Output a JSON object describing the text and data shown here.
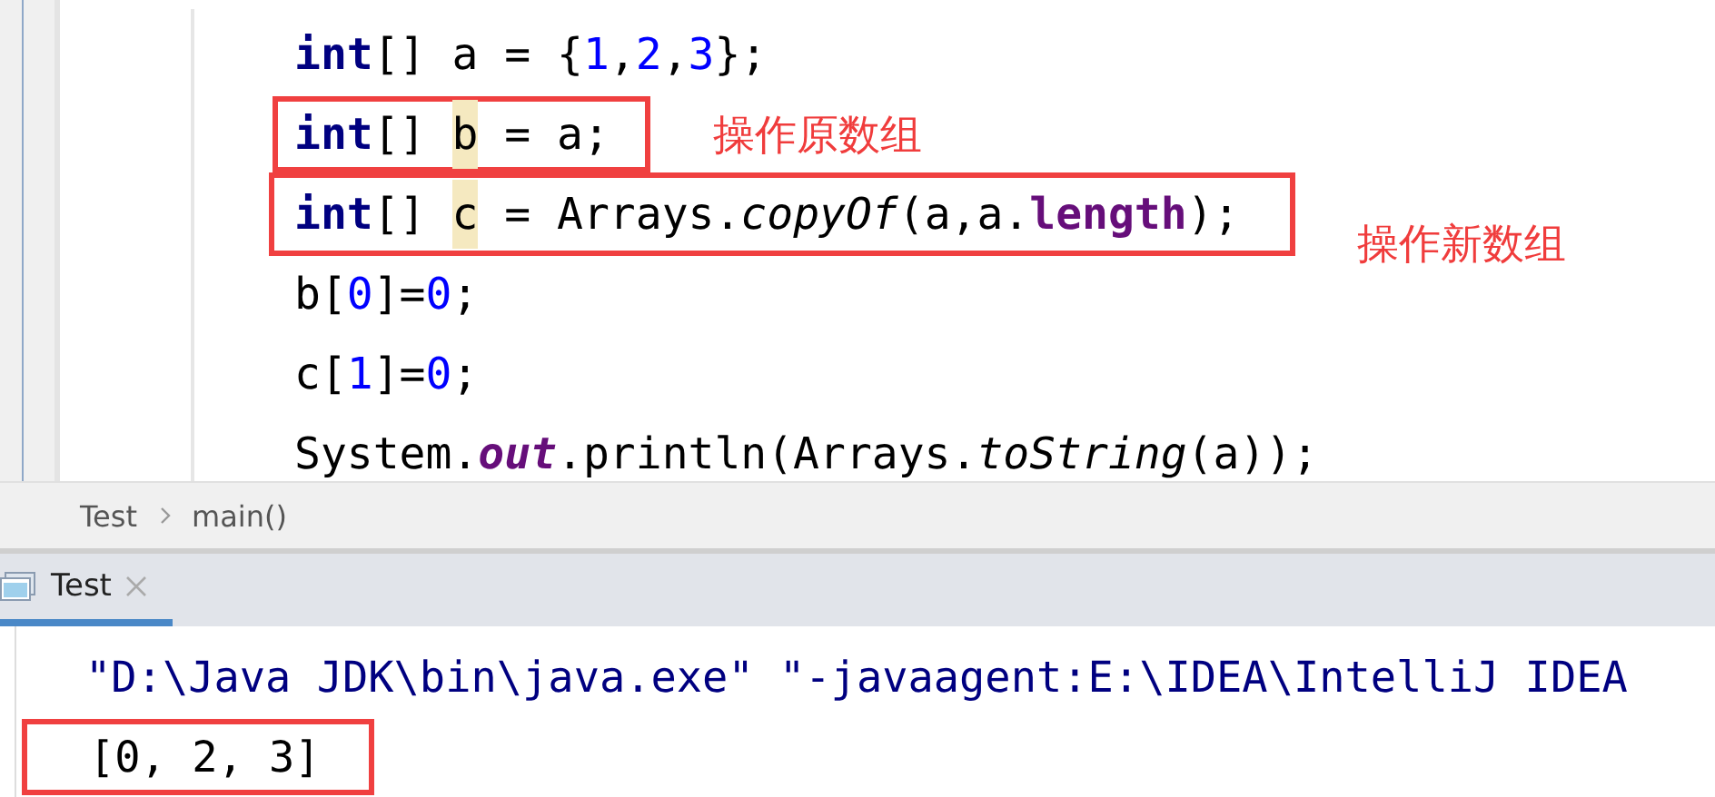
{
  "code_lines": [
    {
      "boxed": false,
      "tokens": [
        {
          "text": "int",
          "kind": "keyword"
        },
        {
          "text": "[] a = {",
          "kind": "plain"
        },
        {
          "text": "1",
          "kind": "number"
        },
        {
          "text": ",",
          "kind": "plain"
        },
        {
          "text": "2",
          "kind": "number"
        },
        {
          "text": ",",
          "kind": "plain"
        },
        {
          "text": "3",
          "kind": "number"
        },
        {
          "text": "};",
          "kind": "plain"
        }
      ]
    },
    {
      "boxed": true,
      "note": "操作原数组",
      "tokens": [
        {
          "text": "int",
          "kind": "keyword"
        },
        {
          "text": "[] ",
          "kind": "plain"
        },
        {
          "text": "b",
          "kind": "highlighted"
        },
        {
          "text": " = a;",
          "kind": "plain"
        }
      ]
    },
    {
      "boxed": true,
      "note": "操作新数组",
      "tokens": [
        {
          "text": "int",
          "kind": "keyword"
        },
        {
          "text": "[] ",
          "kind": "plain"
        },
        {
          "text": "c",
          "kind": "highlighted"
        },
        {
          "text": " = Arrays.",
          "kind": "plain"
        },
        {
          "text": "copyOf",
          "kind": "static_method"
        },
        {
          "text": "(a,a.",
          "kind": "plain"
        },
        {
          "text": "length",
          "kind": "field"
        },
        {
          "text": ");",
          "kind": "plain"
        }
      ]
    },
    {
      "boxed": false,
      "tokens": [
        {
          "text": "b[",
          "kind": "plain"
        },
        {
          "text": "0",
          "kind": "number"
        },
        {
          "text": "]=",
          "kind": "plain"
        },
        {
          "text": "0",
          "kind": "number"
        },
        {
          "text": ";",
          "kind": "plain"
        }
      ]
    },
    {
      "boxed": false,
      "tokens": [
        {
          "text": "c[",
          "kind": "plain"
        },
        {
          "text": "1",
          "kind": "number"
        },
        {
          "text": "]=",
          "kind": "plain"
        },
        {
          "text": "0",
          "kind": "number"
        },
        {
          "text": ";",
          "kind": "plain"
        }
      ]
    },
    {
      "boxed": false,
      "tokens": [
        {
          "text": "System.",
          "kind": "plain"
        },
        {
          "text": "out",
          "kind": "static_field"
        },
        {
          "text": ".println(Arrays.",
          "kind": "plain"
        },
        {
          "text": "toString",
          "kind": "static_method"
        },
        {
          "text": "(a));",
          "kind": "plain"
        }
      ]
    }
  ],
  "breadcrumb": [
    "Test",
    "main()"
  ],
  "run_tabs": [
    {
      "label": "Test",
      "selected": true
    }
  ],
  "console_lines": [
    {
      "kind": "command",
      "boxed": false,
      "text": "\"D:\\Java JDK\\bin\\java.exe\" \"-javaagent:E:\\IDEA\\IntelliJ IDEA"
    },
    {
      "kind": "output",
      "boxed": true,
      "text": "[0, 2, 3]"
    }
  ]
}
